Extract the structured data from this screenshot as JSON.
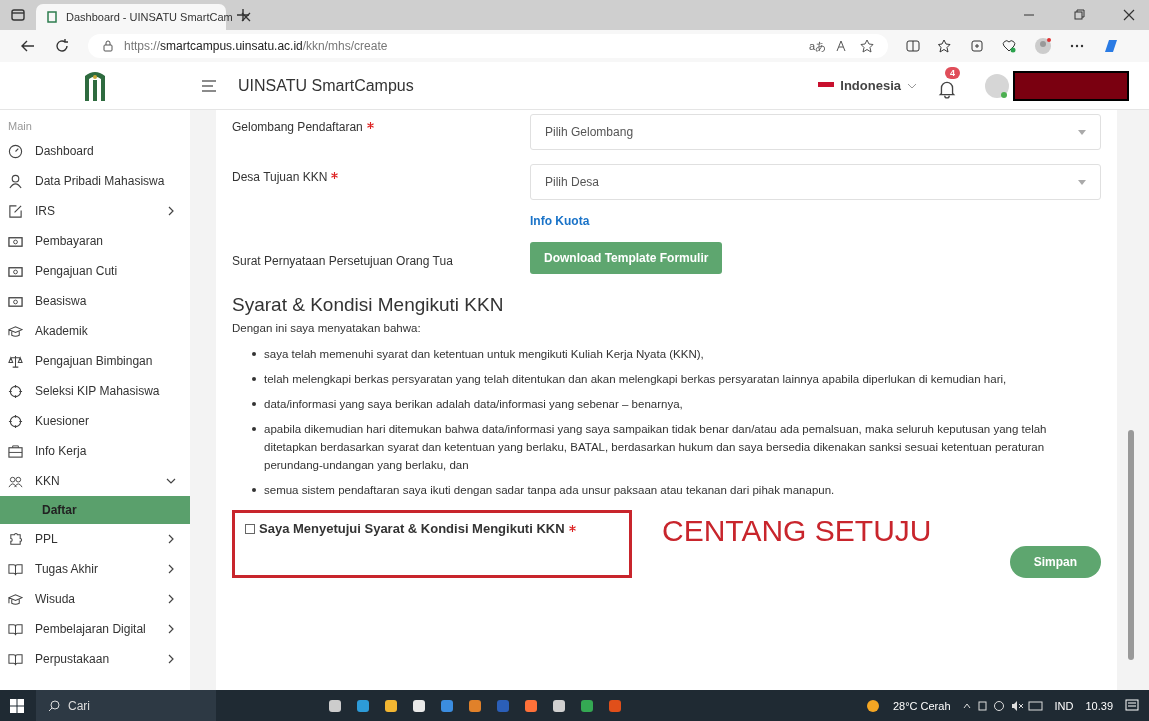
{
  "browser": {
    "tab_title": "Dashboard - UINSATU SmartCam",
    "url_scheme": "https://",
    "url_host": "smartcampus.uinsatu.ac.id",
    "url_path": "/kkn/mhs/create",
    "read_aloud": "aあ"
  },
  "header": {
    "app_title": "UINSATU SmartCampus",
    "language": "Indonesia",
    "notification_count": "4"
  },
  "sidebar": {
    "section": "Main",
    "items": [
      {
        "label": "Dashboard"
      },
      {
        "label": "Data Pribadi Mahasiswa"
      },
      {
        "label": "IRS",
        "expanded": false
      },
      {
        "label": "Pembayaran"
      },
      {
        "label": "Pengajuan Cuti"
      },
      {
        "label": "Beasiswa"
      },
      {
        "label": "Akademik"
      },
      {
        "label": "Pengajuan Bimbingan"
      },
      {
        "label": "Seleksi KIP Mahasiswa"
      },
      {
        "label": "Kuesioner"
      },
      {
        "label": "Info Kerja"
      },
      {
        "label": "KKN",
        "expanded": true,
        "children": [
          {
            "label": "Daftar",
            "selected": true
          }
        ]
      },
      {
        "label": "PPL",
        "expanded": false
      },
      {
        "label": "Tugas Akhir",
        "expanded": false
      },
      {
        "label": "Wisuda",
        "expanded": false
      },
      {
        "label": "Pembelajaran Digital",
        "expanded": false
      },
      {
        "label": "Perpustakaan",
        "expanded": false
      }
    ]
  },
  "form": {
    "fields": [
      {
        "label": "Gelombang Pendaftaran",
        "required": true,
        "placeholder": "Pilih Gelombang"
      },
      {
        "label": "Desa Tujuan KKN",
        "required": true,
        "placeholder": "Pilih Desa"
      }
    ],
    "quota_link": "Info Kuota",
    "letter_label": "Surat Pernyataan Persetujuan Orang Tua",
    "download_button": "Download Template Formulir"
  },
  "terms": {
    "title": "Syarat & Kondisi Mengikuti KKN",
    "intro": "Dengan ini saya menyatakan bahwa:",
    "bullets": [
      "saya telah memenuhi syarat dan ketentuan untuk mengikuti Kuliah Kerja Nyata (KKN),",
      "telah melengkapi berkas persyaratan yang telah ditentukan dan akan melengkapi berkas persyaratan lainnya apabila diperlukan di kemudian hari,",
      "data/informasi yang saya berikan adalah data/informasi yang sebenar – benarnya,",
      "apabila dikemudian hari ditemukan bahwa data/informasi yang saya sampaikan tidak benar dan/atau ada pemalsuan, maka seluruh keputusan yang telah ditetapkan berdasarkan syarat dan ketentuan yang berlaku, BATAL, berdasarkan hukum dan saya bersedia dikenakan sanksi sesuai ketentuan peraturan perundang-undangan yang berlaku, dan",
      "semua sistem pendaftaran saya ikuti dengan sadar tanpa ada unsur paksaan atau tekanan dari pihak manapun."
    ],
    "agree": {
      "label": "Saya Menyetujui Syarat & Kondisi Mengikuti KKN",
      "required": true,
      "checked": false
    },
    "annotation": "CENTANG SETUJU",
    "save_button": "Simpan"
  },
  "taskbar": {
    "search": "Cari",
    "weather": "28°C Cerah",
    "language": "IND",
    "time": "10.39"
  }
}
